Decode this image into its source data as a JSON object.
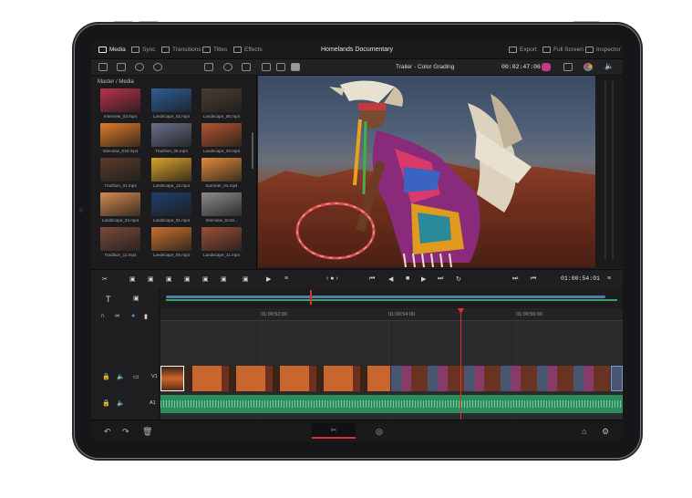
{
  "topbar": {
    "items": [
      {
        "label": "Media",
        "icon": "media-icon",
        "active": true
      },
      {
        "label": "Sync",
        "icon": "sync-icon",
        "active": false
      },
      {
        "label": "Transitions",
        "icon": "transitions-icon",
        "active": false
      },
      {
        "label": "Titles",
        "icon": "titles-icon",
        "active": false
      },
      {
        "label": "Effects",
        "icon": "effects-icon",
        "active": false
      }
    ],
    "project_title": "Homelands Documentary",
    "right_items": [
      {
        "label": "Export",
        "icon": "export-icon"
      },
      {
        "label": "Full Screen",
        "icon": "fullscreen-icon"
      },
      {
        "label": "Inspector",
        "icon": "inspector-icon"
      }
    ]
  },
  "viewer_header": {
    "timeline_name": "Trailer - Color Grading",
    "timecode": "00:02:47:06"
  },
  "media_pool": {
    "path": "Master / Media",
    "clips": [
      {
        "name": "Interview_03.mp4",
        "color": "#b8324a"
      },
      {
        "name": "Landscape_02.mp4",
        "color": "#2f5d96"
      },
      {
        "name": "Landscape_06.mp4",
        "color": "#4a3d33"
      },
      {
        "name": "Interview_010.mp4",
        "color": "#e07b2a"
      },
      {
        "name": "Tradition_06.mp4",
        "color": "#6a6f8a"
      },
      {
        "name": "Landscape_03.mp4",
        "color": "#b4552f"
      },
      {
        "name": "Tradition_01.mp4",
        "color": "#5a3b2a"
      },
      {
        "name": "Landscape_12.mp4",
        "color": "#d9a32a"
      },
      {
        "name": "Summer_04.mp4",
        "color": "#e08a3a"
      },
      {
        "name": "Landscape_24.mp4",
        "color": "#d68a4f"
      },
      {
        "name": "Landscape_01.mp4",
        "color": "#1f3f6a"
      },
      {
        "name": "Interview_Scotl...",
        "color": "#8c8c8c"
      },
      {
        "name": "Tradition_11.mp4",
        "color": "#7a4a3a"
      },
      {
        "name": "Landscape_09.mp4",
        "color": "#c8702e"
      },
      {
        "name": "Landscape_11.mp4",
        "color": "#9a4f35"
      }
    ]
  },
  "transport": {
    "timecode": "01:00:54:01"
  },
  "timeline": {
    "ticks": [
      "01:00:52:00",
      "01:00:54:00",
      "01:00:56:00"
    ],
    "audio_label": "A1",
    "video_label": "V1"
  },
  "colors": {
    "accent": "#e0302d",
    "audio": "#2b8d5b",
    "timeline_bar": "#4f7fa8"
  }
}
